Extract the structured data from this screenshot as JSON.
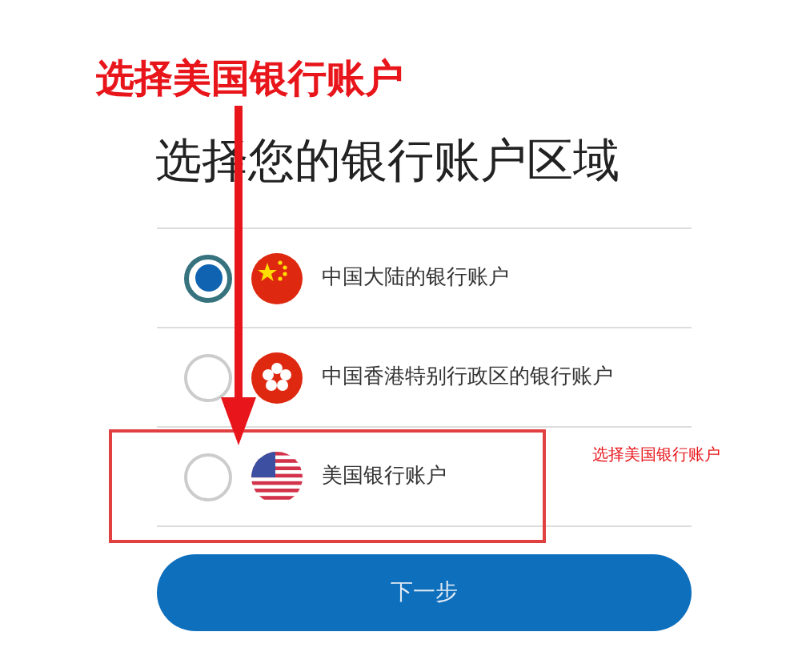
{
  "annotation": {
    "label": "选择美国银行账户",
    "note": "选择美国银行账户"
  },
  "title": "选择您的银行账户区域",
  "options": [
    {
      "label": "中国大陆的银行账户",
      "kind": "cn",
      "selected": true,
      "highlighted": false
    },
    {
      "label": "中国香港特别行政区的银行账户",
      "kind": "hk",
      "selected": false,
      "highlighted": false
    },
    {
      "label": "美国银行账户",
      "kind": "us",
      "selected": false,
      "highlighted": true
    }
  ],
  "button": {
    "label": "下一步"
  }
}
